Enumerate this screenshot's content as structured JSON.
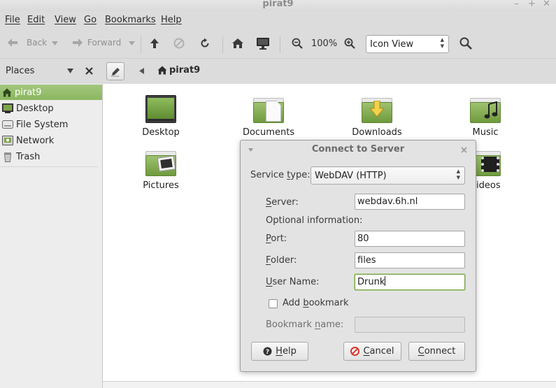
{
  "window": {
    "title": "pirat9",
    "controls": [
      "–",
      "+",
      "✕"
    ]
  },
  "menubar": {
    "items": [
      {
        "first": "F",
        "rest": "ile"
      },
      {
        "first": "E",
        "rest": "dit"
      },
      {
        "first": "V",
        "rest": "iew"
      },
      {
        "first": "G",
        "rest": "o"
      },
      {
        "first": "B",
        "rest": "ookmarks"
      },
      {
        "first": "H",
        "rest": "elp"
      }
    ]
  },
  "toolbar": {
    "back_label": "Back",
    "forward_label": "Forward",
    "zoom_level": "100%",
    "view_mode": "Icon View"
  },
  "location": {
    "current_folder": "pirat9"
  },
  "sidebar": {
    "header": "Places",
    "items": [
      {
        "label": "pirat9",
        "icon": "home-icon"
      },
      {
        "label": "Desktop",
        "icon": "desktop-icon"
      },
      {
        "label": "File System",
        "icon": "drive-icon"
      },
      {
        "label": "Network",
        "icon": "network-icon"
      },
      {
        "label": "Trash",
        "icon": "trash-icon"
      }
    ]
  },
  "files": [
    {
      "label": "Desktop",
      "emblem": "desktop"
    },
    {
      "label": "Documents",
      "emblem": "document"
    },
    {
      "label": "Downloads",
      "emblem": "download"
    },
    {
      "label": "Music",
      "emblem": "music"
    },
    {
      "label": "Pictures",
      "emblem": "picture"
    },
    {
      "label": "Videos",
      "emblem": "video"
    }
  ],
  "statusbar": {
    "text": ""
  },
  "dialog": {
    "title": "Connect to Server",
    "service_type_label_u": "t",
    "service_type_label_pre": "Service ",
    "service_type_label_post": "ype:",
    "service_type_value": "WebDAV (HTTP)",
    "server_label_u": "S",
    "server_label_rest": "erver:",
    "server_value": "webdav.6h.nl",
    "optional_label": "Optional information:",
    "port_label_u": "P",
    "port_label_rest": "ort:",
    "port_value": "80",
    "folder_label_u": "F",
    "folder_label_rest": "older:",
    "folder_value": "files",
    "username_label_u": "U",
    "username_label_rest": "ser Name:",
    "username_value": "Drunk",
    "add_bookmark_pre": "Add ",
    "add_bookmark_u": "b",
    "add_bookmark_post": "ookmark",
    "add_bookmark_checked": false,
    "bookmark_name_label_pre": "Bookmark ",
    "bookmark_name_label_u": "n",
    "bookmark_name_label_post": "ame:",
    "bookmark_name_value": "",
    "help_u": "H",
    "help_rest": "elp",
    "cancel_u": "C",
    "cancel_rest": "ancel",
    "connect_u": "C",
    "connect_rest": "onnect"
  },
  "colors": {
    "accent": "#8ab65f",
    "folder_green": "#7ea64b"
  }
}
